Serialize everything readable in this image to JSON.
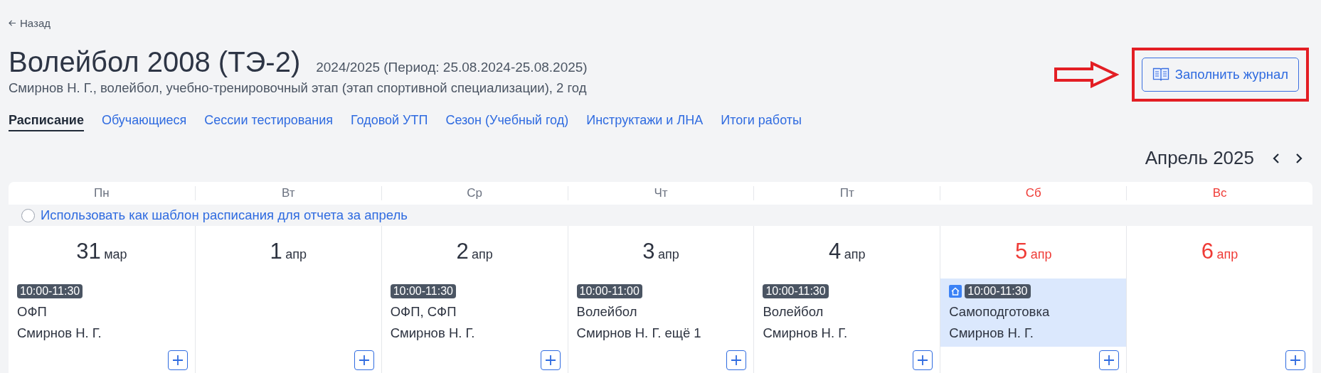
{
  "back_link": "Назад",
  "title": "Волейбол 2008 (ТЭ-2)",
  "season": "2024/2025 (Период: 25.08.2024-25.08.2025)",
  "description": "Смирнов Н. Г., волейбол, учебно-тренировочный этап (этап спортивной специализации), 2 год",
  "fill_journal_button": "Заполнить журнал",
  "tabs": [
    {
      "label": "Расписание",
      "selected": true
    },
    {
      "label": "Обучающиеся",
      "selected": false
    },
    {
      "label": "Сессии тестирования",
      "selected": false
    },
    {
      "label": "Годовой УТП",
      "selected": false
    },
    {
      "label": "Сезон (Учебный год)",
      "selected": false
    },
    {
      "label": "Инструктажи и ЛНА",
      "selected": false
    },
    {
      "label": "Итоги работы",
      "selected": false
    }
  ],
  "month": "Апрель 2025",
  "weekdays": [
    {
      "label": "Пн",
      "weekend": false
    },
    {
      "label": "Вт",
      "weekend": false
    },
    {
      "label": "Ср",
      "weekend": false
    },
    {
      "label": "Чт",
      "weekend": false
    },
    {
      "label": "Пт",
      "weekend": false
    },
    {
      "label": "Сб",
      "weekend": true
    },
    {
      "label": "Вс",
      "weekend": true
    }
  ],
  "template_option": {
    "label": "Использовать как шаблон расписания для отчета за апрель",
    "checked": false
  },
  "days": [
    {
      "number": "31",
      "month": "мар",
      "weekend": false,
      "events": [
        {
          "kind": "regular",
          "highlighted": false,
          "time": "10:00-11:30",
          "title": "ОФП",
          "teacher": "Смирнов Н. Г."
        }
      ]
    },
    {
      "number": "1",
      "month": "апр",
      "weekend": false
    },
    {
      "number": "2",
      "month": "апр",
      "weekend": false,
      "events": [
        {
          "kind": "regular",
          "highlighted": false,
          "time": "10:00-11:30",
          "title": "ОФП, СФП",
          "teacher": "Смирнов Н. Г."
        }
      ]
    },
    {
      "number": "3",
      "month": "апр",
      "weekend": false,
      "events": [
        {
          "kind": "regular",
          "highlighted": false,
          "time": "10:00-11:00",
          "title": "Волейбол",
          "teacher": "Смирнов Н. Г. ещё 1"
        }
      ]
    },
    {
      "number": "4",
      "month": "апр",
      "weekend": false,
      "events": [
        {
          "kind": "regular",
          "highlighted": false,
          "time": "10:00-11:30",
          "title": "Волейбол",
          "teacher": "Смирнов Н. Г."
        }
      ]
    },
    {
      "number": "5",
      "month": "апр",
      "weekend": true,
      "events": [
        {
          "kind": "home",
          "highlighted": true,
          "time": "10:00-11:30",
          "title": "Самоподготовка",
          "teacher": "Смирнов Н. Г."
        }
      ]
    },
    {
      "number": "6",
      "month": "апр",
      "weekend": true
    }
  ]
}
